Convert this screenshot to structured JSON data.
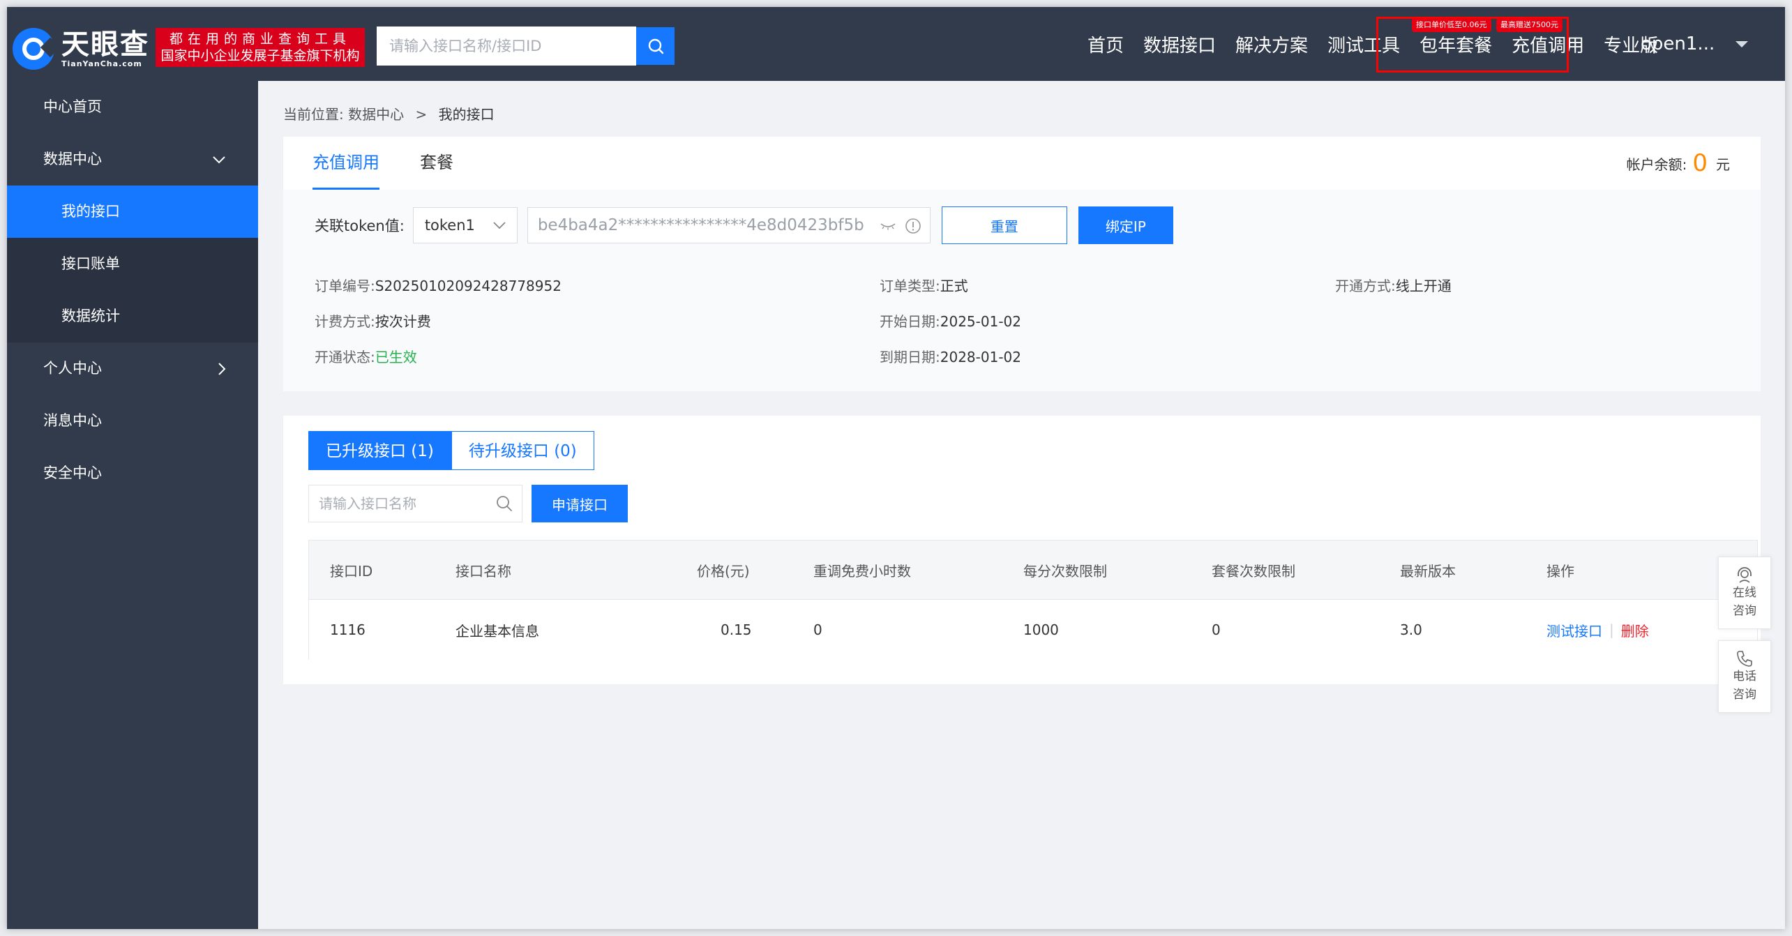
{
  "header": {
    "logo_cn": "天眼查",
    "logo_en": "TianYanCha.com",
    "slogan_line1": "都在用的商业查询工具",
    "slogan_line2": "国家中小企业发展子基金旗下机构",
    "search_placeholder": "请输入接口名称/接口ID",
    "nav": [
      "首页",
      "数据接口",
      "解决方案",
      "测试工具",
      "包年套餐",
      "充值调用",
      "专业版"
    ],
    "tag_annual": "接口单价低至0.06元",
    "tag_recharge": "最高赠送7500元",
    "user_name": "open1...",
    "highlight_color": "#ff0000"
  },
  "sidebar": {
    "items": [
      {
        "label": "中心首页"
      },
      {
        "label": "数据中心",
        "arrow": "chevron-down-icon"
      },
      {
        "label": "我的接口",
        "active": true
      },
      {
        "label": "接口账单"
      },
      {
        "label": "数据统计"
      },
      {
        "label": "个人中心",
        "arrow": "chevron-right-icon"
      },
      {
        "label": "消息中心"
      },
      {
        "label": "安全中心"
      }
    ]
  },
  "breadcrumb": {
    "prefix": "当前位置:",
    "parent": "数据中心",
    "separator": ">",
    "current": "我的接口"
  },
  "account": {
    "tabs": [
      "充值调用",
      "套餐"
    ],
    "balance_label": "帐户余额:",
    "balance_value": "0",
    "balance_unit": "元",
    "token_label": "关联token值:",
    "token_select": "token1",
    "token_value": "be4ba4a2****************4e8d0423bf5b",
    "reset_label": "重置",
    "bind_ip_label": "绑定IP"
  },
  "order": {
    "number_label": "订单编号:",
    "number": "S20250102092428778952",
    "type_label": "订单类型:",
    "type": "正式",
    "open_mode_label": "开通方式:",
    "open_mode": "线上开通",
    "billing_label": "计费方式:",
    "billing": "按次计费",
    "start_label": "开始日期:",
    "start": "2025-01-02",
    "status_label": "开通状态:",
    "status": "已生效",
    "end_label": "到期日期:",
    "end": "2028-01-02"
  },
  "apis": {
    "seg_upgraded": "已升级接口 (1)",
    "seg_pending": "待升级接口 (0)",
    "search_placeholder": "请输入接口名称",
    "apply_label": "申请接口",
    "columns": [
      "接口ID",
      "接口名称",
      "价格(元)",
      "重调免费小时数",
      "每分次数限制",
      "套餐次数限制",
      "最新版本",
      "操作"
    ],
    "rows": [
      {
        "id": "1116",
        "name": "企业基本信息",
        "price": "0.15",
        "free_hours": "0",
        "per_minute": "1000",
        "package_limit": "0",
        "version": "3.0",
        "op_test": "测试接口",
        "op_delete": "删除"
      }
    ]
  },
  "float": {
    "online_line1": "在线",
    "online_line2": "咨询",
    "phone_line1": "电话",
    "phone_line2": "咨询"
  },
  "colors": {
    "primary": "#1677ff",
    "sidebar_bg": "#323b4b",
    "balance": "#ff8a00",
    "status_green": "#26b24c",
    "delete_red": "#f5222d"
  }
}
